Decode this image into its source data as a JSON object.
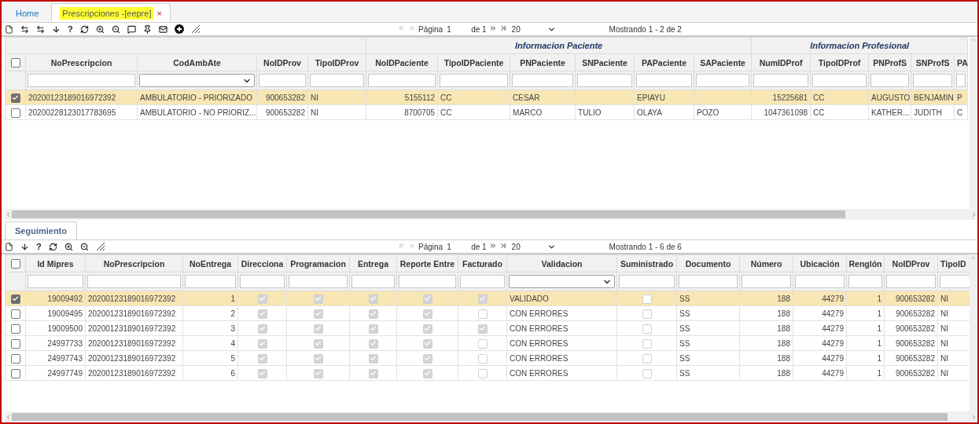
{
  "tabs": [
    {
      "label": "Home",
      "selected": false
    },
    {
      "label": "Prescripciones -[eepre]",
      "selected": true,
      "close": "×"
    }
  ],
  "top_toolbar": {
    "tools": [
      {
        "kind": "new"
      },
      {
        "kind": "swap"
      },
      {
        "kind": "swap"
      },
      {
        "kind": "down"
      },
      {
        "kind": "help",
        "label": "?"
      },
      {
        "kind": "refresh"
      },
      {
        "kind": "zoom-in"
      },
      {
        "kind": "zoom-out"
      },
      {
        "kind": "comment"
      },
      {
        "kind": "pin"
      },
      {
        "kind": "mail"
      },
      {
        "kind": "add"
      },
      {
        "kind": "resize"
      }
    ],
    "pager": {
      "page_label": "Página",
      "page": "1",
      "of": "de 1",
      "page_size": "20",
      "showing": "Mostrando 1 - 2 de 2"
    }
  },
  "top_grid": {
    "groups": [
      "Informacion Paciente",
      "Informacion Profesional"
    ],
    "select_all": false,
    "columns": [
      {
        "label": "NoPrescripcion",
        "kind": "text"
      },
      {
        "label": "CodAmbAte",
        "kind": "select"
      },
      {
        "label": "NoIDProv",
        "kind": "text"
      },
      {
        "label": "TipoIDProv",
        "kind": "text"
      },
      {
        "label": "NoIDPaciente",
        "kind": "text"
      },
      {
        "label": "TipoIDPaciente",
        "kind": "text"
      },
      {
        "label": "PNPaciente",
        "kind": "text"
      },
      {
        "label": "SNPaciente",
        "kind": "text"
      },
      {
        "label": "PAPaciente",
        "kind": "text"
      },
      {
        "label": "SAPaciente",
        "kind": "text"
      },
      {
        "label": "NumIDProf",
        "kind": "text"
      },
      {
        "label": "TipoIDProf",
        "kind": "text"
      },
      {
        "label": "PNProfS",
        "kind": "text"
      },
      {
        "label": "SNProfS",
        "kind": "text"
      },
      {
        "label": "PA",
        "kind": "text"
      }
    ],
    "rows": [
      {
        "selected": true,
        "cells": [
          "20200123189016972392",
          "AMBULATORIO - PRIORIZADO",
          "900653282",
          "NI",
          "5155112",
          "CC",
          "CESAR",
          null,
          "EPIAYU",
          null,
          "15225681",
          "CC",
          "AUGUSTO",
          "BENJAMIN",
          "P"
        ]
      },
      {
        "selected": false,
        "cells": [
          "20200228123017783695",
          "AMBULATORIO - NO PRIORIZ...",
          "900653282",
          "NI",
          "8700705",
          "CC",
          "MARCO",
          "TULIO",
          "OLAYA",
          "POZO",
          "1047361098",
          "CC",
          "KATHER...",
          "JUDITH",
          "C"
        ]
      }
    ]
  },
  "detail_tabs": [
    {
      "label": "Seguimiento",
      "selected": true
    }
  ],
  "bottom_toolbar": {
    "tools": [
      {
        "kind": "new"
      },
      {
        "kind": "down"
      },
      {
        "kind": "help",
        "label": "?"
      },
      {
        "kind": "refresh"
      },
      {
        "kind": "zoom-in"
      },
      {
        "kind": "zoom-out"
      },
      {
        "kind": "resize"
      }
    ],
    "pager": {
      "page_label": "Página",
      "page": "1",
      "of": "de 1",
      "page_size": "20",
      "showing": "Mostrando 1 - 6 de 6"
    }
  },
  "bottom_grid": {
    "select_all": false,
    "columns": [
      {
        "label": "Id Mipres",
        "kind": "text"
      },
      {
        "label": "NoPrescripcion",
        "kind": "text"
      },
      {
        "label": "NoEntrega",
        "kind": "text"
      },
      {
        "label": "Direcciona",
        "kind": "text"
      },
      {
        "label": "Programacion",
        "kind": "text"
      },
      {
        "label": "Entrega",
        "kind": "text"
      },
      {
        "label": "Reporte Entre",
        "kind": "text"
      },
      {
        "label": "Facturado",
        "kind": "text"
      },
      {
        "label": "Validacion",
        "kind": "select"
      },
      {
        "label": "Suministrado",
        "kind": "text"
      },
      {
        "label": "Documento",
        "kind": "text"
      },
      {
        "label": "Número",
        "kind": "text"
      },
      {
        "label": "Ubicación",
        "kind": "text"
      },
      {
        "label": "Renglón",
        "kind": "text"
      },
      {
        "label": "NoIDProv",
        "kind": "text"
      },
      {
        "label": "TipoID",
        "kind": "text"
      }
    ],
    "rows": [
      {
        "selected": true,
        "cells": [
          "19009492",
          "20200123189016972392",
          "1",
          true,
          true,
          true,
          true,
          true,
          "VALIDADO",
          false,
          "SS",
          "188",
          "44279",
          "1",
          "900653282",
          "NI"
        ]
      },
      {
        "selected": false,
        "cells": [
          "19009495",
          "20200123189016972392",
          "2",
          true,
          true,
          true,
          true,
          false,
          "CON ERRORES",
          false,
          "SS",
          "188",
          "44279",
          "1",
          "900653282",
          "NI"
        ]
      },
      {
        "selected": false,
        "cells": [
          "19009500",
          "20200123189016972392",
          "3",
          true,
          true,
          true,
          true,
          true,
          "CON ERRORES",
          false,
          "SS",
          "188",
          "44279",
          "1",
          "900653282",
          "NI"
        ]
      },
      {
        "selected": false,
        "cells": [
          "24997733",
          "20200123189016972392",
          "4",
          true,
          true,
          true,
          true,
          false,
          "CON ERRORES",
          false,
          "SS",
          "188",
          "44279",
          "1",
          "900653282",
          "NI"
        ]
      },
      {
        "selected": false,
        "cells": [
          "24997743",
          "20200123189016972392",
          "5",
          true,
          true,
          true,
          true,
          false,
          "CON ERRORES",
          false,
          "SS",
          "188",
          "44279",
          "1",
          "900653282",
          "NI"
        ]
      },
      {
        "selected": false,
        "cells": [
          "24997749",
          "20200123189016972392",
          "6",
          true,
          true,
          true,
          true,
          false,
          "CON ERRORES",
          false,
          "SS",
          "188",
          "44279",
          "1",
          "900653282",
          "NI"
        ]
      }
    ]
  }
}
